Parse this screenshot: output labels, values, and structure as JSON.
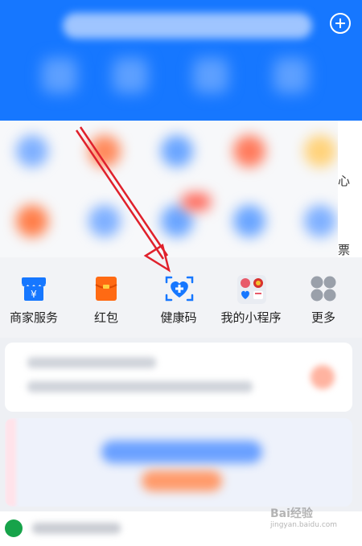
{
  "quick_actions": [
    {
      "label": "商家服务",
      "icon": "merchant-store-icon"
    },
    {
      "label": "红包",
      "icon": "red-packet-icon"
    },
    {
      "label": "健康码",
      "icon": "health-code-icon"
    },
    {
      "label": "我的小程序",
      "icon": "mini-programs-icon"
    },
    {
      "label": "更多",
      "icon": "more-grid-icon"
    }
  ],
  "side_labels": {
    "top": "心",
    "bottom": "票"
  },
  "watermark": {
    "text": "Bai经验",
    "sub": "jingyan.baidu.com"
  },
  "colors": {
    "brand_blue": "#1677ff",
    "annotation_red": "#e0212c",
    "red_packet": "#ff6a13"
  }
}
